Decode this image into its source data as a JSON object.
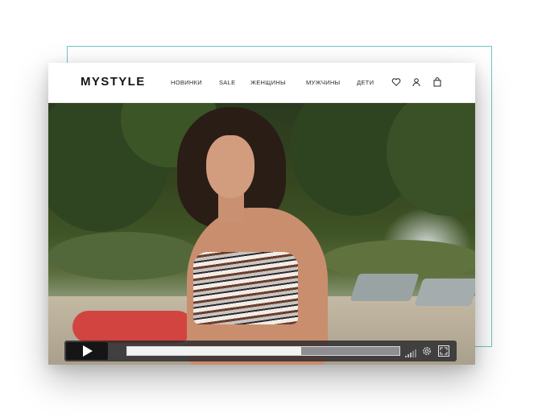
{
  "header": {
    "logo": "MYSTYLE",
    "nav": [
      {
        "label": "НОВИНКИ"
      },
      {
        "label": "SALE"
      },
      {
        "label": "ЖЕНЩИНЫ"
      },
      {
        "label": "МУЖЧИНЫ"
      },
      {
        "label": "ДЕТИ"
      }
    ],
    "icons": [
      "heart-icon",
      "user-icon",
      "shopping-bag-icon"
    ]
  },
  "video": {
    "progress": 0.64,
    "controls": [
      "play-icon",
      "volume-icon",
      "settings-icon",
      "fullscreen-icon"
    ]
  },
  "colors": {
    "frame_accent": "#6fc7c2",
    "logo": "#151515",
    "control_bar": "#232328"
  }
}
